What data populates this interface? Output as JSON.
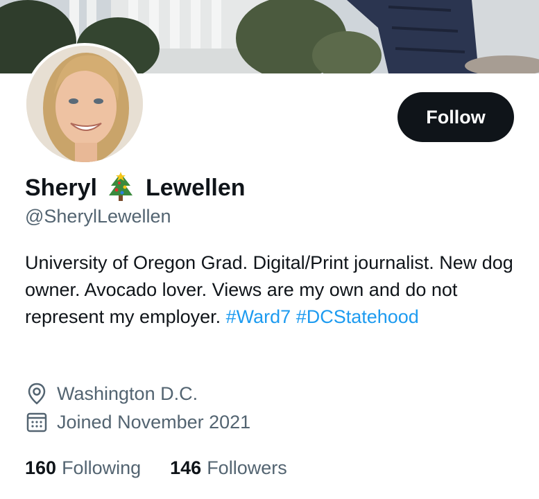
{
  "profile": {
    "display_name_first": "Sheryl",
    "display_name_last": "Lewellen",
    "name_emoji": "christmas-tree-icon",
    "handle": "@SherylLewellen",
    "follow_label": "Follow",
    "bio": {
      "text_line": "University of Oregon Grad. Digital/Print journalist. New dog owner. Avocado lover. Views are my own and do not represent my employer.",
      "hashtags": [
        "#Ward7",
        "#DCStatehood"
      ]
    },
    "location": "Washington D.C.",
    "joined": "Joined November 2021",
    "stats": {
      "following_count": "160",
      "following_label": "Following",
      "followers_count": "146",
      "followers_label": "Followers"
    }
  },
  "colors": {
    "accent": "#1d9bf0",
    "text_primary": "#0f1419",
    "text_secondary": "#536471",
    "button_bg": "#0f1419"
  }
}
